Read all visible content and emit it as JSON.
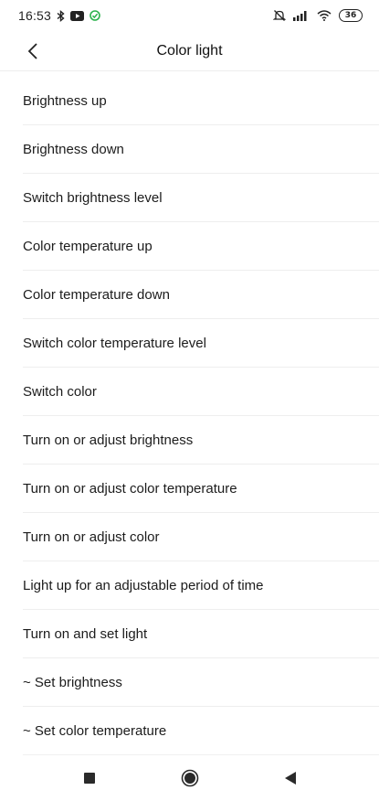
{
  "status_bar": {
    "time": "16:53",
    "battery": "36",
    "icons": [
      "bluetooth-icon",
      "youtube-icon",
      "sync-icon",
      "mute-icon",
      "signal-icon",
      "wifi-icon",
      "battery-icon"
    ]
  },
  "header": {
    "title": "Color light",
    "back_icon": "chevron-left-icon"
  },
  "actions": [
    "Brightness up",
    "Brightness down",
    "Switch brightness level",
    "Color temperature up",
    "Color temperature down",
    "Switch color temperature level",
    "Switch color",
    "Turn on or adjust brightness",
    "Turn on or adjust color temperature",
    "Turn on or adjust color",
    "Light up for an adjustable period of time",
    "Turn on and set light",
    "~ Set brightness",
    "~ Set color temperature"
  ],
  "nav_bar": {
    "icons": [
      "recents-square-icon",
      "home-circle-icon",
      "back-triangle-icon"
    ]
  },
  "colors": {
    "sync_green": "#2bb24c",
    "divider": "#eeeeee"
  }
}
